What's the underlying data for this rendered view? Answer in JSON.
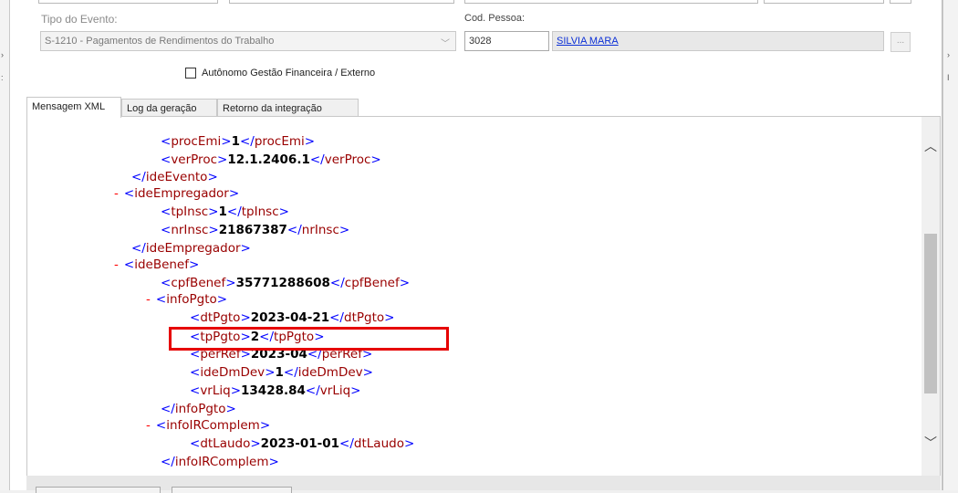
{
  "form": {
    "tipo_evento_label": "Tipo do Evento:",
    "tipo_evento_value": "S-1210 - Pagamentos de Rendimentos do Trabalho",
    "cod_pessoa_label": "Cod. Pessoa:",
    "cod_pessoa_value": "3028",
    "pessoa_nome": "SILVIA MARA",
    "lookup_button": "...",
    "autonomo_label": "Autônomo Gestão Financeira / Externo"
  },
  "tabs": [
    {
      "label": "Mensagem XML"
    },
    {
      "label": "Log da geração"
    },
    {
      "label": "Retorno da integração"
    }
  ],
  "xml_lines": [
    {
      "tag": "procEmi",
      "value": "1"
    },
    {
      "tag": "verProc",
      "value": "12.1.2406.1"
    },
    {
      "tag": "/ideEvento"
    },
    {
      "tag": "ideEmpregador",
      "collapse": "-"
    },
    {
      "tag": "tpInsc",
      "value": "1"
    },
    {
      "tag": "nrInsc",
      "value": "21867387"
    },
    {
      "tag": "/ideEmpregador"
    },
    {
      "tag": "ideBenef",
      "collapse": "-"
    },
    {
      "tag": "cpfBenef",
      "value": "35771288608"
    },
    {
      "tag": "infoPgto",
      "collapse": "-"
    },
    {
      "tag": "dtPgto",
      "value": "2023-04-21"
    },
    {
      "tag": "tpPgto",
      "value": "2"
    },
    {
      "tag": "perRef",
      "value": "2023-04"
    },
    {
      "tag": "ideDmDev",
      "value": "1"
    },
    {
      "tag": "vrLiq",
      "value": "13428.84"
    },
    {
      "tag": "/infoPgto"
    },
    {
      "tag": "infoIRComplem",
      "collapse": "-"
    },
    {
      "tag": "dtLaudo",
      "value": "2023-01-01"
    },
    {
      "tag": "/infoIRComplem"
    }
  ],
  "colors": {
    "xml_bracket": "#0000ff",
    "xml_tag": "#990000",
    "collapse_marker": "#ff0000",
    "highlight_box": "#e60000",
    "link_text": "#0b2fd6"
  },
  "icons": {
    "dropdown": "chevron-down-icon",
    "scroll_up": "chevron-up-icon",
    "scroll_down": "chevron-down-icon"
  }
}
